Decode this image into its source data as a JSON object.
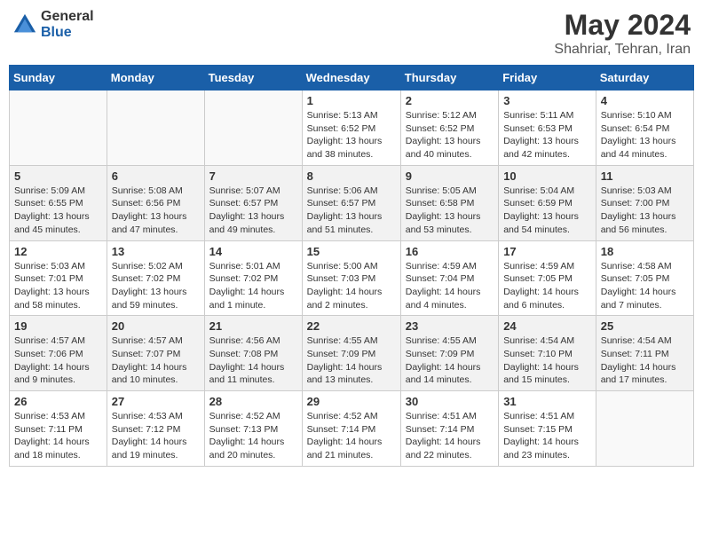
{
  "header": {
    "logo_general": "General",
    "logo_blue": "Blue",
    "title": "May 2024",
    "location": "Shahriar, Tehran, Iran"
  },
  "days_of_week": [
    "Sunday",
    "Monday",
    "Tuesday",
    "Wednesday",
    "Thursday",
    "Friday",
    "Saturday"
  ],
  "weeks": [
    {
      "alt": false,
      "days": [
        {
          "num": "",
          "info": ""
        },
        {
          "num": "",
          "info": ""
        },
        {
          "num": "",
          "info": ""
        },
        {
          "num": "1",
          "info": "Sunrise: 5:13 AM\nSunset: 6:52 PM\nDaylight: 13 hours\nand 38 minutes."
        },
        {
          "num": "2",
          "info": "Sunrise: 5:12 AM\nSunset: 6:52 PM\nDaylight: 13 hours\nand 40 minutes."
        },
        {
          "num": "3",
          "info": "Sunrise: 5:11 AM\nSunset: 6:53 PM\nDaylight: 13 hours\nand 42 minutes."
        },
        {
          "num": "4",
          "info": "Sunrise: 5:10 AM\nSunset: 6:54 PM\nDaylight: 13 hours\nand 44 minutes."
        }
      ]
    },
    {
      "alt": true,
      "days": [
        {
          "num": "5",
          "info": "Sunrise: 5:09 AM\nSunset: 6:55 PM\nDaylight: 13 hours\nand 45 minutes."
        },
        {
          "num": "6",
          "info": "Sunrise: 5:08 AM\nSunset: 6:56 PM\nDaylight: 13 hours\nand 47 minutes."
        },
        {
          "num": "7",
          "info": "Sunrise: 5:07 AM\nSunset: 6:57 PM\nDaylight: 13 hours\nand 49 minutes."
        },
        {
          "num": "8",
          "info": "Sunrise: 5:06 AM\nSunset: 6:57 PM\nDaylight: 13 hours\nand 51 minutes."
        },
        {
          "num": "9",
          "info": "Sunrise: 5:05 AM\nSunset: 6:58 PM\nDaylight: 13 hours\nand 53 minutes."
        },
        {
          "num": "10",
          "info": "Sunrise: 5:04 AM\nSunset: 6:59 PM\nDaylight: 13 hours\nand 54 minutes."
        },
        {
          "num": "11",
          "info": "Sunrise: 5:03 AM\nSunset: 7:00 PM\nDaylight: 13 hours\nand 56 minutes."
        }
      ]
    },
    {
      "alt": false,
      "days": [
        {
          "num": "12",
          "info": "Sunrise: 5:03 AM\nSunset: 7:01 PM\nDaylight: 13 hours\nand 58 minutes."
        },
        {
          "num": "13",
          "info": "Sunrise: 5:02 AM\nSunset: 7:02 PM\nDaylight: 13 hours\nand 59 minutes."
        },
        {
          "num": "14",
          "info": "Sunrise: 5:01 AM\nSunset: 7:02 PM\nDaylight: 14 hours\nand 1 minute."
        },
        {
          "num": "15",
          "info": "Sunrise: 5:00 AM\nSunset: 7:03 PM\nDaylight: 14 hours\nand 2 minutes."
        },
        {
          "num": "16",
          "info": "Sunrise: 4:59 AM\nSunset: 7:04 PM\nDaylight: 14 hours\nand 4 minutes."
        },
        {
          "num": "17",
          "info": "Sunrise: 4:59 AM\nSunset: 7:05 PM\nDaylight: 14 hours\nand 6 minutes."
        },
        {
          "num": "18",
          "info": "Sunrise: 4:58 AM\nSunset: 7:05 PM\nDaylight: 14 hours\nand 7 minutes."
        }
      ]
    },
    {
      "alt": true,
      "days": [
        {
          "num": "19",
          "info": "Sunrise: 4:57 AM\nSunset: 7:06 PM\nDaylight: 14 hours\nand 9 minutes."
        },
        {
          "num": "20",
          "info": "Sunrise: 4:57 AM\nSunset: 7:07 PM\nDaylight: 14 hours\nand 10 minutes."
        },
        {
          "num": "21",
          "info": "Sunrise: 4:56 AM\nSunset: 7:08 PM\nDaylight: 14 hours\nand 11 minutes."
        },
        {
          "num": "22",
          "info": "Sunrise: 4:55 AM\nSunset: 7:09 PM\nDaylight: 14 hours\nand 13 minutes."
        },
        {
          "num": "23",
          "info": "Sunrise: 4:55 AM\nSunset: 7:09 PM\nDaylight: 14 hours\nand 14 minutes."
        },
        {
          "num": "24",
          "info": "Sunrise: 4:54 AM\nSunset: 7:10 PM\nDaylight: 14 hours\nand 15 minutes."
        },
        {
          "num": "25",
          "info": "Sunrise: 4:54 AM\nSunset: 7:11 PM\nDaylight: 14 hours\nand 17 minutes."
        }
      ]
    },
    {
      "alt": false,
      "days": [
        {
          "num": "26",
          "info": "Sunrise: 4:53 AM\nSunset: 7:11 PM\nDaylight: 14 hours\nand 18 minutes."
        },
        {
          "num": "27",
          "info": "Sunrise: 4:53 AM\nSunset: 7:12 PM\nDaylight: 14 hours\nand 19 minutes."
        },
        {
          "num": "28",
          "info": "Sunrise: 4:52 AM\nSunset: 7:13 PM\nDaylight: 14 hours\nand 20 minutes."
        },
        {
          "num": "29",
          "info": "Sunrise: 4:52 AM\nSunset: 7:14 PM\nDaylight: 14 hours\nand 21 minutes."
        },
        {
          "num": "30",
          "info": "Sunrise: 4:51 AM\nSunset: 7:14 PM\nDaylight: 14 hours\nand 22 minutes."
        },
        {
          "num": "31",
          "info": "Sunrise: 4:51 AM\nSunset: 7:15 PM\nDaylight: 14 hours\nand 23 minutes."
        },
        {
          "num": "",
          "info": ""
        }
      ]
    }
  ]
}
